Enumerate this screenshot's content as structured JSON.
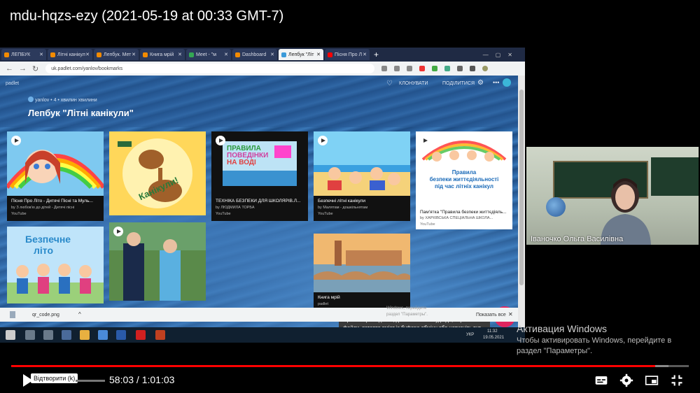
{
  "video": {
    "title": "mdu-hqzs-ezy (2021-05-19 at 00:33 GMT-7)"
  },
  "browser": {
    "tabs": [
      {
        "label": "ЛЕПБУК",
        "color": "#f28b00",
        "active": false
      },
      {
        "label": "Літні канікул",
        "color": "#f28b00",
        "active": false
      },
      {
        "label": "Лепбук. Мет",
        "color": "#f28b00",
        "active": false
      },
      {
        "label": "Книга мрій",
        "color": "#f28b00",
        "active": false
      },
      {
        "label": "Meet - \"м",
        "color": "#34a853",
        "active": false
      },
      {
        "label": "Dashboard",
        "color": "#f28b00",
        "active": false
      },
      {
        "label": "Лепбук \"Літ",
        "color": "#3b9ad9",
        "active": true
      },
      {
        "label": "Пісня Про Л",
        "color": "#ff0000",
        "active": false
      }
    ],
    "new_tab_label": "+",
    "url": "uk.padlet.com/yanlov/bookmarks"
  },
  "padlet": {
    "logo": "padlet",
    "author_line": "yanlov  •  4  •  хвилин хвилини",
    "name": "Лепбук \"Літні канікули\"",
    "clone_label": "КЛОНУВАТИ",
    "share_label": "ПОДІЛИТИСЯ",
    "cards": [
      {
        "title": "Пісня Про Літо - Дитячі Пісні та Муль...",
        "sub": "by З любов'ю до дітей - Дитячі пісні",
        "source": "YouTube",
        "video": true
      },
      {
        "title": "Канікули!",
        "sub": "",
        "source": "",
        "video": false
      },
      {
        "title": "ТЕХНІКА БЕЗПЕКИ ДЛЯ ШКОЛЯРІВ.Л...",
        "sub": "by ЛЮДМИЛА ТОРБА",
        "source": "YouTube",
        "video": true
      },
      {
        "title": "Безпечні літні канікули",
        "sub": "by Малятам - дошкільнятам",
        "source": "YouTube",
        "video": true
      },
      {
        "title": "Пам'ятка \"Правила безпеки життєдіяль...",
        "sub": "by ХАРКІВСЬКА СПЕЦІАЛЬНА ШКОЛА...",
        "source": "YouTube",
        "video": true
      },
      {
        "title": "Безпечне літо",
        "sub": "",
        "source": "",
        "video": false
      },
      {
        "title": "",
        "sub": "",
        "source": "",
        "video": true
      },
      {
        "title": "Книга мрій",
        "sub": "padlet",
        "source": "",
        "video": false
      }
    ],
    "thumb_texts": {
      "kanikuly": "Канікули!",
      "pravyla_1": "ПРАВИЛА",
      "pravyla_2": "ПОВЕДІНКИ",
      "pravyla_3": "НА ВОДІ",
      "pamyatka_1": "Правила",
      "pamyatka_2": "безпеки життєдіяльності",
      "pamyatka_3": "під час літніх канікул",
      "bezpechne_1": "Безпечне",
      "bezpechne_2": "літо"
    },
    "tooltip": "Щоб створити допис, двічі натисніть будь-де, перетягніть файли, вставте вміст із буфера обміну або натисніть тут.",
    "fab_icon": "pencil-icon",
    "fab_glyph": "✎"
  },
  "downloads": {
    "file": "qr_code.png",
    "show_all": "Показать все",
    "ghost_1": "Windows, перейдите",
    "ghost_2": "раздел \"Параметры\"."
  },
  "taskbar": {
    "clock_time": "11:32",
    "clock_date": "19.05.2021",
    "lang": "УКР"
  },
  "webcam": {
    "name": "Іваночко Ольга Василівна"
  },
  "activation": {
    "title": "Активация Windows",
    "sub": "Чтобы активировать Windows, перейдите в раздел \"Параметры\"."
  },
  "player": {
    "play_tooltip": "Відтворити (k)",
    "time": "58:03 / 1:01:03",
    "played_fraction": 0.9508,
    "loaded_fraction": 0.97
  },
  "colors": {
    "progress_played": "#ff0000",
    "fab": "#e0245e"
  }
}
